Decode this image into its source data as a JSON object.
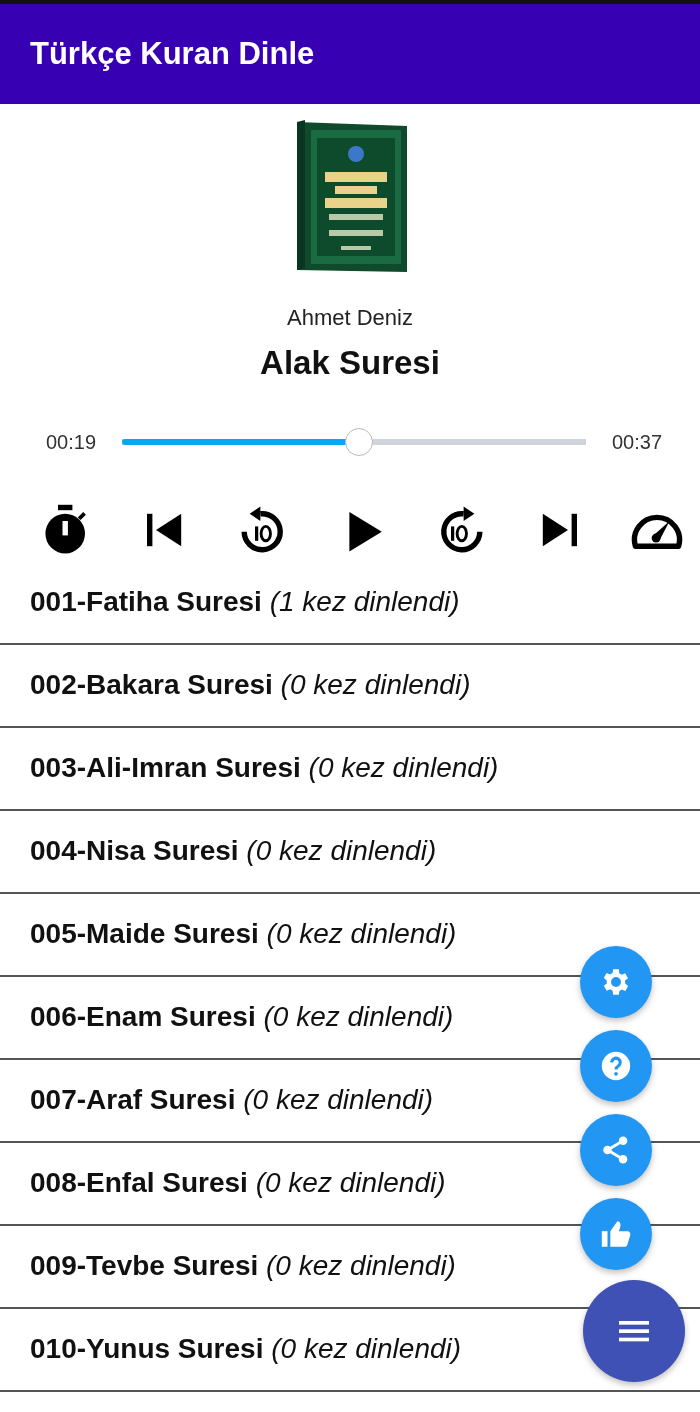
{
  "app_bar": {
    "title": "Türkçe Kuran Dinle"
  },
  "player": {
    "artist": "Ahmet Deniz",
    "track_title": "Alak Suresi",
    "elapsed": "00:19",
    "duration": "00:37",
    "progress": {
      "level": 0.51
    },
    "controls": [
      {
        "kind": "timer"
      },
      {
        "kind": "previous"
      },
      {
        "kind": "rewind"
      },
      {
        "kind": "play"
      },
      {
        "kind": "forward"
      },
      {
        "kind": "next"
      },
      {
        "kind": "speed"
      }
    ]
  },
  "tracks": [
    {
      "text": "**001-Fatiha Suresi** *(1 kez dinlendi)*"
    },
    {
      "text": "**002-Bakara Suresi** *(0 kez dinlendi)*"
    },
    {
      "text": "**003-Ali-Imran Suresi** *(0 kez dinlendi)*"
    },
    {
      "text": "**004-Nisa Suresi** *(0 kez dinlendi)*"
    },
    {
      "text": "**005-Maide Suresi** *(0 kez dinlendi)*"
    },
    {
      "text": "**006-Enam Suresi** *(0 kez dinlendi)*"
    },
    {
      "text": "**007-Araf Suresi** *(0 kez dinlendi)*"
    },
    {
      "text": "**008-Enfal Suresi** *(0 kez dinlendi)*"
    },
    {
      "text": "**009-Tevbe Suresi** *(0 kez dinlendi)*"
    },
    {
      "text": "**010-Yunus Suresi** *(0 kez dinlendi)*"
    }
  ],
  "fab_menu": {
    "actions": [
      {
        "kind": "settings"
      },
      {
        "kind": "help"
      },
      {
        "kind": "share"
      },
      {
        "kind": "like"
      }
    ],
    "main": {
      "kind": "menu"
    }
  }
}
